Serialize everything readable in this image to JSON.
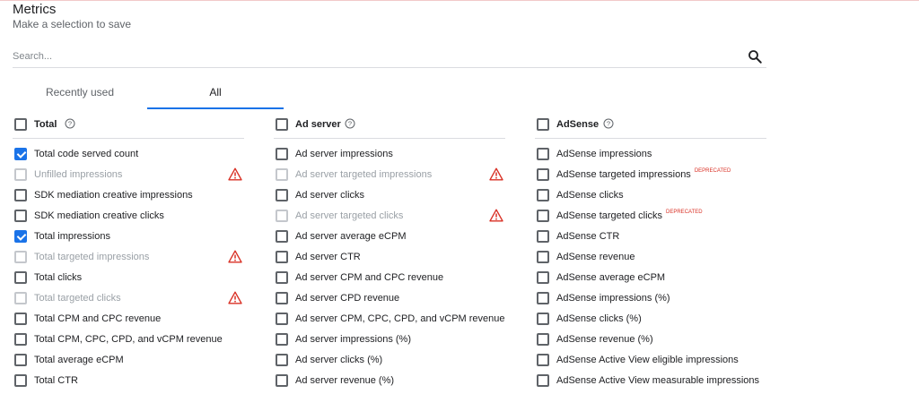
{
  "header": {
    "title": "Metrics",
    "subtitle": "Make a selection to save"
  },
  "search": {
    "placeholder": "Search..."
  },
  "tabs": [
    {
      "label": "Recently used"
    },
    {
      "label": "All"
    }
  ],
  "columns": [
    {
      "heading": "Total",
      "rows": [
        {
          "label": "Total code served count",
          "checked": true,
          "disabled": false,
          "warning": false
        },
        {
          "label": "Unfilled impressions",
          "checked": false,
          "disabled": true,
          "warning": true
        },
        {
          "label": "SDK mediation creative impressions",
          "checked": false,
          "disabled": false,
          "warning": false
        },
        {
          "label": "SDK mediation creative clicks",
          "checked": false,
          "disabled": false,
          "warning": false
        },
        {
          "label": "Total impressions",
          "checked": true,
          "disabled": false,
          "warning": false
        },
        {
          "label": "Total targeted impressions",
          "checked": false,
          "disabled": true,
          "warning": true
        },
        {
          "label": "Total clicks",
          "checked": false,
          "disabled": false,
          "warning": false
        },
        {
          "label": "Total targeted clicks",
          "checked": false,
          "disabled": true,
          "warning": true
        },
        {
          "label": "Total CPM and CPC revenue",
          "checked": false,
          "disabled": false,
          "warning": false
        },
        {
          "label": "Total CPM, CPC, CPD, and vCPM revenue",
          "checked": false,
          "disabled": false,
          "warning": false
        },
        {
          "label": "Total average eCPM",
          "checked": false,
          "disabled": false,
          "warning": false
        },
        {
          "label": "Total CTR",
          "checked": false,
          "disabled": false,
          "warning": false
        }
      ]
    },
    {
      "heading": "Ad server",
      "rows": [
        {
          "label": "Ad server impressions",
          "checked": false,
          "disabled": false,
          "warning": false
        },
        {
          "label": "Ad server targeted impressions",
          "checked": false,
          "disabled": true,
          "warning": true
        },
        {
          "label": "Ad server clicks",
          "checked": false,
          "disabled": false,
          "warning": false
        },
        {
          "label": "Ad server targeted clicks",
          "checked": false,
          "disabled": true,
          "warning": true
        },
        {
          "label": "Ad server average eCPM",
          "checked": false,
          "disabled": false,
          "warning": false
        },
        {
          "label": "Ad server CTR",
          "checked": false,
          "disabled": false,
          "warning": false
        },
        {
          "label": "Ad server CPM and CPC revenue",
          "checked": false,
          "disabled": false,
          "warning": false
        },
        {
          "label": "Ad server CPD revenue",
          "checked": false,
          "disabled": false,
          "warning": false
        },
        {
          "label": "Ad server CPM, CPC, CPD, and vCPM revenue",
          "checked": false,
          "disabled": false,
          "warning": false
        },
        {
          "label": "Ad server impressions (%)",
          "checked": false,
          "disabled": false,
          "warning": false
        },
        {
          "label": "Ad server clicks (%)",
          "checked": false,
          "disabled": false,
          "warning": false
        },
        {
          "label": "Ad server revenue (%)",
          "checked": false,
          "disabled": false,
          "warning": false
        }
      ]
    },
    {
      "heading": "AdSense",
      "rows": [
        {
          "label": "AdSense impressions",
          "checked": false,
          "disabled": false,
          "warning": false
        },
        {
          "label": "AdSense targeted impressions",
          "checked": false,
          "disabled": false,
          "warning": false,
          "badge": "DEPRECATED"
        },
        {
          "label": "AdSense clicks",
          "checked": false,
          "disabled": false,
          "warning": false
        },
        {
          "label": "AdSense targeted clicks",
          "checked": false,
          "disabled": false,
          "warning": false,
          "badge": "DEPRECATED"
        },
        {
          "label": "AdSense CTR",
          "checked": false,
          "disabled": false,
          "warning": false
        },
        {
          "label": "AdSense revenue",
          "checked": false,
          "disabled": false,
          "warning": false
        },
        {
          "label": "AdSense average eCPM",
          "checked": false,
          "disabled": false,
          "warning": false
        },
        {
          "label": "AdSense impressions (%)",
          "checked": false,
          "disabled": false,
          "warning": false
        },
        {
          "label": "AdSense clicks (%)",
          "checked": false,
          "disabled": false,
          "warning": false
        },
        {
          "label": "AdSense revenue (%)",
          "checked": false,
          "disabled": false,
          "warning": false
        },
        {
          "label": "AdSense Active View eligible impressions",
          "checked": false,
          "disabled": false,
          "warning": false
        },
        {
          "label": "AdSense Active View measurable impressions",
          "checked": false,
          "disabled": false,
          "warning": false
        }
      ]
    }
  ],
  "colors": {
    "accent": "#1a73e8",
    "warning": "#d93025",
    "disabled_text": "#9aa0a6"
  },
  "icons": {
    "search": "search-icon",
    "help": "help-circle-icon",
    "warning": "warning-triangle-icon"
  }
}
